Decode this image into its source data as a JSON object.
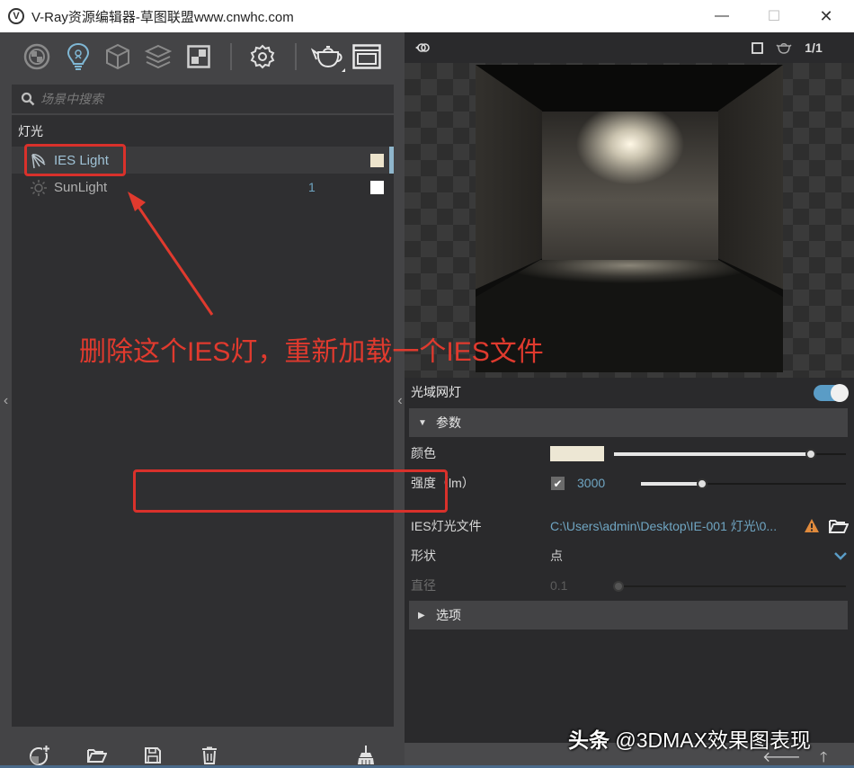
{
  "window": {
    "title": "V-Ray资源编辑器-草图联盟www.cnwhc.com",
    "logo_glyph": "V",
    "minimize": "—",
    "maximize": "☐",
    "close": "✕"
  },
  "toolbar": {
    "icons": [
      "materials-icon",
      "lights-icon",
      "geometry-icon",
      "layers-icon",
      "textures-icon",
      "settings-icon",
      "render-teapot-icon",
      "frame-buffer-icon"
    ],
    "active": "lights-icon"
  },
  "search": {
    "placeholder": "场景中搜索",
    "value": ""
  },
  "outliner": {
    "category": "灯光",
    "items": [
      {
        "name": "IES Light",
        "icon": "ies-light-icon",
        "count": "",
        "swatch_color": "#ede4cc",
        "selected": true
      },
      {
        "name": "SunLight",
        "icon": "sun-icon",
        "count": "1",
        "swatch_color": "#ffffff",
        "selected": false
      }
    ]
  },
  "annotation": {
    "text": "删除这个IES灯，重新加载一个IES文件",
    "color": "#e03a2e"
  },
  "bottom_toolbar": {
    "icons": [
      "add-asset-icon",
      "open-folder-icon",
      "save-icon",
      "delete-icon",
      "purge-broom-icon"
    ]
  },
  "preview_toolbar": {
    "swatch_preview_icon": "preview-options-icon",
    "square_icon": "square-icon",
    "teapot_icon": "teapot-icon",
    "ratio_label": "1/1"
  },
  "properties": {
    "light_name": "光域网灯",
    "enabled": true,
    "params_section": "参数",
    "color_label": "颜色",
    "color_value": "#ede7d4",
    "color_slider": 0.85,
    "intensity_label": "强度（lm）",
    "intensity_checked": true,
    "intensity_value": "3000",
    "intensity_slider": 0.3,
    "ies_file_label": "IES灯光文件",
    "ies_file_path": "C:\\Users\\admin\\Desktop\\IE-001 灯光\\0...",
    "shape_label": "形状",
    "shape_value": "点",
    "diameter_label": "直径",
    "diameter_value": "0.1",
    "diameter_slider": 0.0,
    "options_section": "选项"
  },
  "watermark": {
    "brand": "头条",
    "handle": "@3DMAX效果图表现"
  },
  "nav": {
    "back": "🡐",
    "up": "🡑"
  },
  "colors": {
    "accent": "#5a9cc6",
    "highlight_red": "#d9312b",
    "value_blue": "#6fa5c2"
  }
}
